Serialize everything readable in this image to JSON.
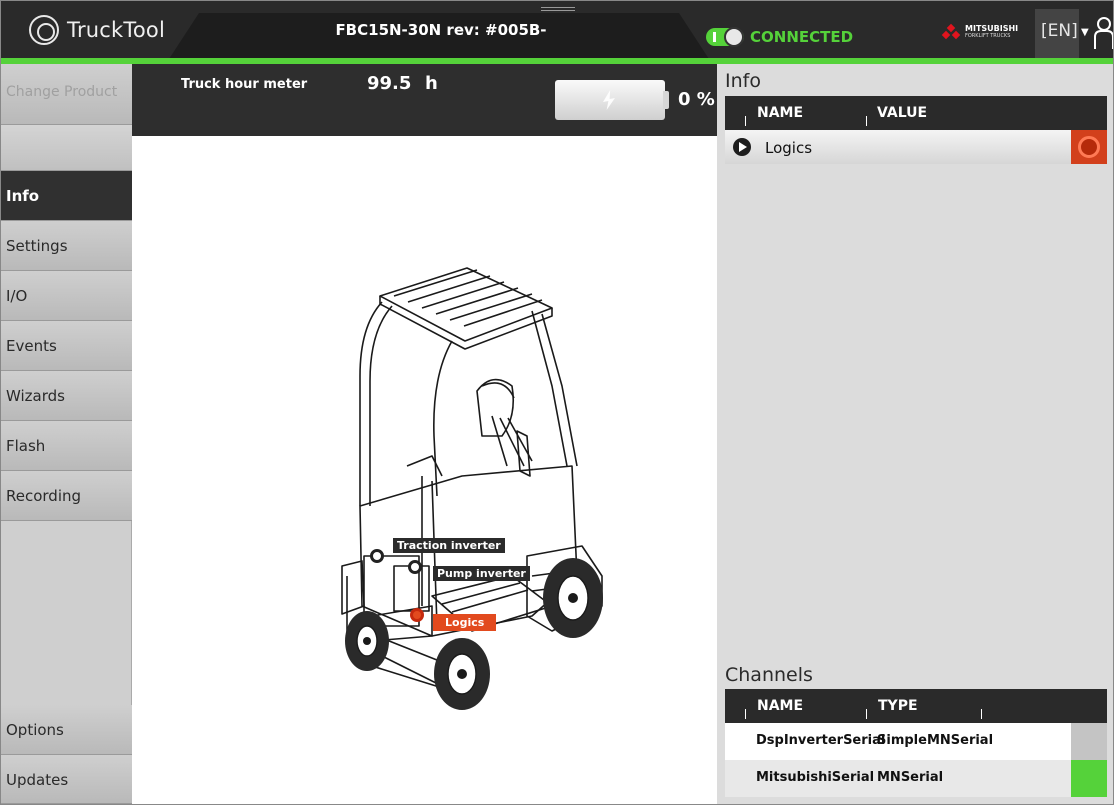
{
  "app": {
    "name": "TruckTool"
  },
  "header": {
    "product": "FBC15N-30N rev: #005B-",
    "connection": "CONNECTED",
    "brand_line1": "MITSUBISHI",
    "brand_line2": "FORKLIFT TRUCKS",
    "language": "[EN]"
  },
  "sidebar": {
    "items": [
      {
        "label": "Change Product",
        "state": "disabled"
      },
      {
        "label": "",
        "state": "blank"
      },
      {
        "label": "Info",
        "state": "active"
      },
      {
        "label": "Settings",
        "state": "normal"
      },
      {
        "label": "I/O",
        "state": "normal"
      },
      {
        "label": "Events",
        "state": "normal"
      },
      {
        "label": "Wizards",
        "state": "normal"
      },
      {
        "label": "Flash",
        "state": "normal"
      },
      {
        "label": "Recording",
        "state": "normal"
      }
    ],
    "bottom": [
      {
        "label": "Options"
      },
      {
        "label": "Updates"
      }
    ]
  },
  "meter": {
    "label": "Truck hour meter",
    "value": "99.5",
    "unit": "h",
    "battery_pct": "0 %"
  },
  "diagram": {
    "labels": {
      "traction": "Traction inverter",
      "pump": "Pump inverter",
      "logics": "Logics"
    }
  },
  "info": {
    "title": "Info",
    "columns": [
      "NAME",
      "VALUE"
    ],
    "rows": [
      {
        "name": "Logics",
        "status": "error"
      }
    ]
  },
  "channels": {
    "title": "Channels",
    "columns": [
      "NAME",
      "TYPE"
    ],
    "rows": [
      {
        "name": "DspInverterSerial",
        "type": "SimpleMNSerial",
        "status_color": "#c4c4c4"
      },
      {
        "name": "MitsubishiSerial",
        "type": "MNSerial",
        "status_color": "#55d23a"
      }
    ]
  },
  "colors": {
    "accent": "#55d23a",
    "error": "#d2401c"
  }
}
